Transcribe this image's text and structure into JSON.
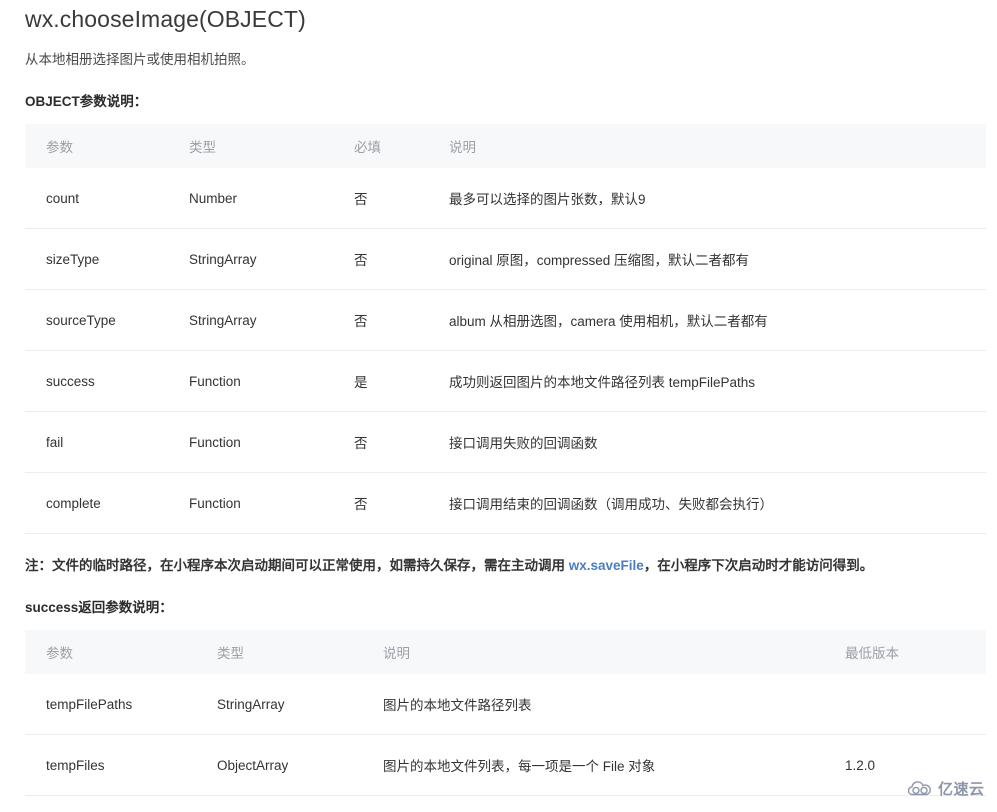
{
  "page": {
    "title": "wx.chooseImage(OBJECT)",
    "intro": "从本地相册选择图片或使用相机拍照。"
  },
  "object_section": {
    "heading": "OBJECT参数说明：",
    "table": {
      "headers": [
        "参数",
        "类型",
        "必填",
        "说明"
      ],
      "rows": [
        {
          "param": "count",
          "type": "Number",
          "required": "否",
          "desc": "最多可以选择的图片张数，默认9"
        },
        {
          "param": "sizeType",
          "type": "StringArray",
          "required": "否",
          "desc": "original 原图，compressed 压缩图，默认二者都有"
        },
        {
          "param": "sourceType",
          "type": "StringArray",
          "required": "否",
          "desc": "album 从相册选图，camera 使用相机，默认二者都有"
        },
        {
          "param": "success",
          "type": "Function",
          "required": "是",
          "desc": "成功则返回图片的本地文件路径列表 tempFilePaths"
        },
        {
          "param": "fail",
          "type": "Function",
          "required": "否",
          "desc": "接口调用失败的回调函数"
        },
        {
          "param": "complete",
          "type": "Function",
          "required": "否",
          "desc": "接口调用结束的回调函数（调用成功、失败都会执行）"
        }
      ]
    }
  },
  "note": {
    "prefix": "注：文件的临时路径，在小程序本次启动期间可以正常使用，如需持久保存，需在主动调用 ",
    "link_text": "wx.saveFile",
    "suffix": "，在小程序下次启动时才能访问得到。",
    "link_color": "#4a7ec0"
  },
  "success_section": {
    "heading": "success返回参数说明：",
    "table": {
      "headers": [
        "参数",
        "类型",
        "说明",
        "最低版本"
      ],
      "rows": [
        {
          "param": "tempFilePaths",
          "type": "StringArray",
          "desc": "图片的本地文件路径列表",
          "version": ""
        },
        {
          "param": "tempFiles",
          "type": "ObjectArray",
          "desc": "图片的本地文件列表，每一项是一个 File 对象",
          "version": "1.2.0"
        }
      ]
    }
  },
  "watermark": {
    "text": "亿速云",
    "color": "#848ea3"
  }
}
